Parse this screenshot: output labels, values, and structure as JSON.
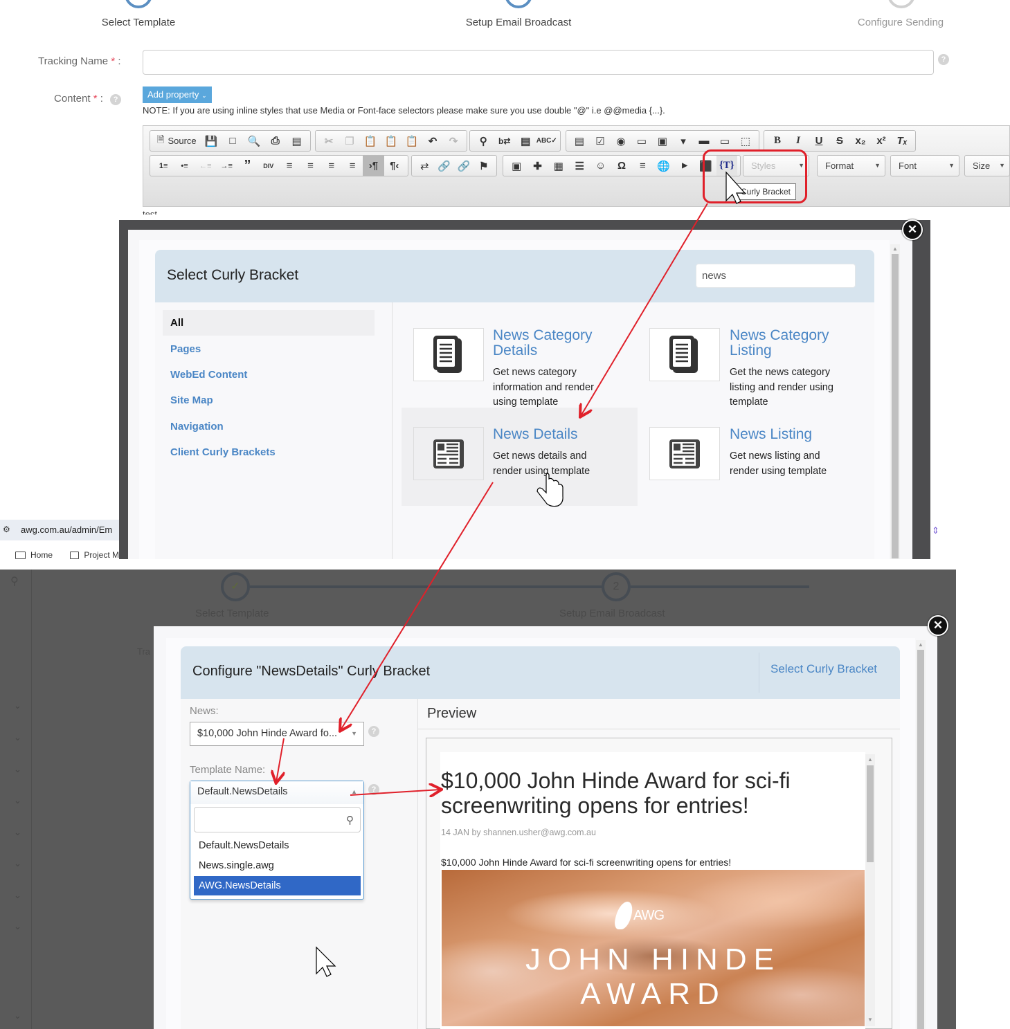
{
  "wizard": {
    "steps": [
      {
        "label": "Select Template",
        "state": "done"
      },
      {
        "label": "Setup Email Broadcast",
        "state": "current"
      },
      {
        "label": "Configure Sending",
        "state": "pending"
      }
    ]
  },
  "form": {
    "tracking_name_label": "Tracking Name",
    "tracking_name_value": "",
    "content_label": "Content",
    "required_mark": "*",
    "colon": ":",
    "add_property_label": "Add property",
    "note": "NOTE: If you are using inline styles that use Media or Font-face selectors please make sure you use double \"@\" i.e @@media {...}.",
    "editor_text": "test"
  },
  "editor": {
    "source_label": "Source",
    "combos": {
      "styles": "Styles",
      "format": "Format",
      "font": "Font",
      "size": "Size"
    },
    "tooltip": "Curly Bracket",
    "row1_groups": [
      [
        "save-icon",
        "new-page-icon",
        "preview-icon",
        "print-icon",
        "templates-icon"
      ],
      [
        "cut-icon",
        "copy-icon",
        "paste-icon",
        "paste-text-icon",
        "paste-word-icon",
        "undo-icon",
        "redo-icon"
      ],
      [
        "find-icon",
        "replace-icon",
        "select-all-icon",
        "spellcheck-icon"
      ],
      [
        "form-icon",
        "checkbox-icon",
        "radio-icon",
        "textfield-icon",
        "textarea-icon",
        "select-icon",
        "button-icon",
        "image-button-icon",
        "hidden-field-icon"
      ],
      [
        "bold-icon",
        "italic-icon",
        "underline-icon",
        "strike-icon",
        "subscript-icon",
        "superscript-icon",
        "remove-format-icon"
      ]
    ],
    "row2_groups": [
      [
        "numbered-list-icon",
        "bulleted-list-icon",
        "outdent-icon",
        "indent-icon",
        "blockquote-icon",
        "div-icon",
        "align-left-icon",
        "align-center-icon",
        "align-right-icon",
        "justify-icon",
        "ltr-icon",
        "rtl-icon"
      ],
      [
        "language-icon",
        "link-icon",
        "unlink-icon",
        "anchor-icon"
      ],
      [
        "image-icon",
        "flash-icon",
        "table-icon",
        "horizontal-rule-icon",
        "smiley-icon",
        "special-char-icon",
        "page-break-icon",
        "iframe-icon",
        "youtube-icon",
        "maximize-icon",
        "curly-bracket-icon"
      ]
    ]
  },
  "select_modal": {
    "title": "Select Curly Bracket",
    "search_value": "news",
    "categories": [
      {
        "label": "All",
        "active": true
      },
      {
        "label": "Pages",
        "active": false
      },
      {
        "label": "WebEd Content",
        "active": false
      },
      {
        "label": "Site Map",
        "active": false
      },
      {
        "label": "Navigation",
        "active": false
      },
      {
        "label": "Client Curly Brackets",
        "active": false
      }
    ],
    "cards": [
      {
        "title": "News Category Details",
        "description": "Get news category information and render using template",
        "icon": "documents-icon"
      },
      {
        "title": "News Category Listing",
        "description": "Get the news category listing and render using template",
        "icon": "documents-icon"
      },
      {
        "title": "News Details",
        "description": "Get news details and render using template",
        "icon": "newspaper-icon",
        "hovered": true
      },
      {
        "title": "News Listing",
        "description": "Get news listing and render using template",
        "icon": "newspaper-icon"
      }
    ]
  },
  "browser": {
    "address": "awg.com.au/admin/Em",
    "bookmarks": [
      "Home",
      "Project M"
    ]
  },
  "background_page": {
    "step_labels": [
      "Select Template",
      "Setup Email Broadcast"
    ],
    "step2_number": "2",
    "tracking_fragment": "Tra"
  },
  "configure_modal": {
    "title": "Configure \"NewsDetails\" Curly Bracket",
    "back_link": "Select Curly Bracket",
    "news_label": "News:",
    "news_value": "$10,000 John Hinde Award fo...",
    "template_label": "Template Name:",
    "template_value": "Default.NewsDetails",
    "template_search_value": "",
    "template_options": [
      {
        "label": "Default.NewsDetails",
        "selected": false
      },
      {
        "label": "News.single.awg",
        "selected": false
      },
      {
        "label": "AWG.NewsDetails",
        "selected": true
      }
    ],
    "preview_label": "Preview",
    "preview": {
      "headline": "$10,000 John Hinde Award for sci-fi screenwriting opens for entries!",
      "meta": "14 JAN by shannen.usher@awg.com.au",
      "body": "$10,000 John Hinde Award for sci-fi screenwriting opens for entries!",
      "image_logo": "AWG",
      "image_line1": "JOHN HINDE",
      "image_line2": "AWARD"
    }
  },
  "colors": {
    "accent_blue": "#4a86c5",
    "header_blue": "#d7e4ee",
    "selected_option": "#3068c6",
    "annotation_red": "#e0202a",
    "add_property": "#5aa7dc"
  }
}
